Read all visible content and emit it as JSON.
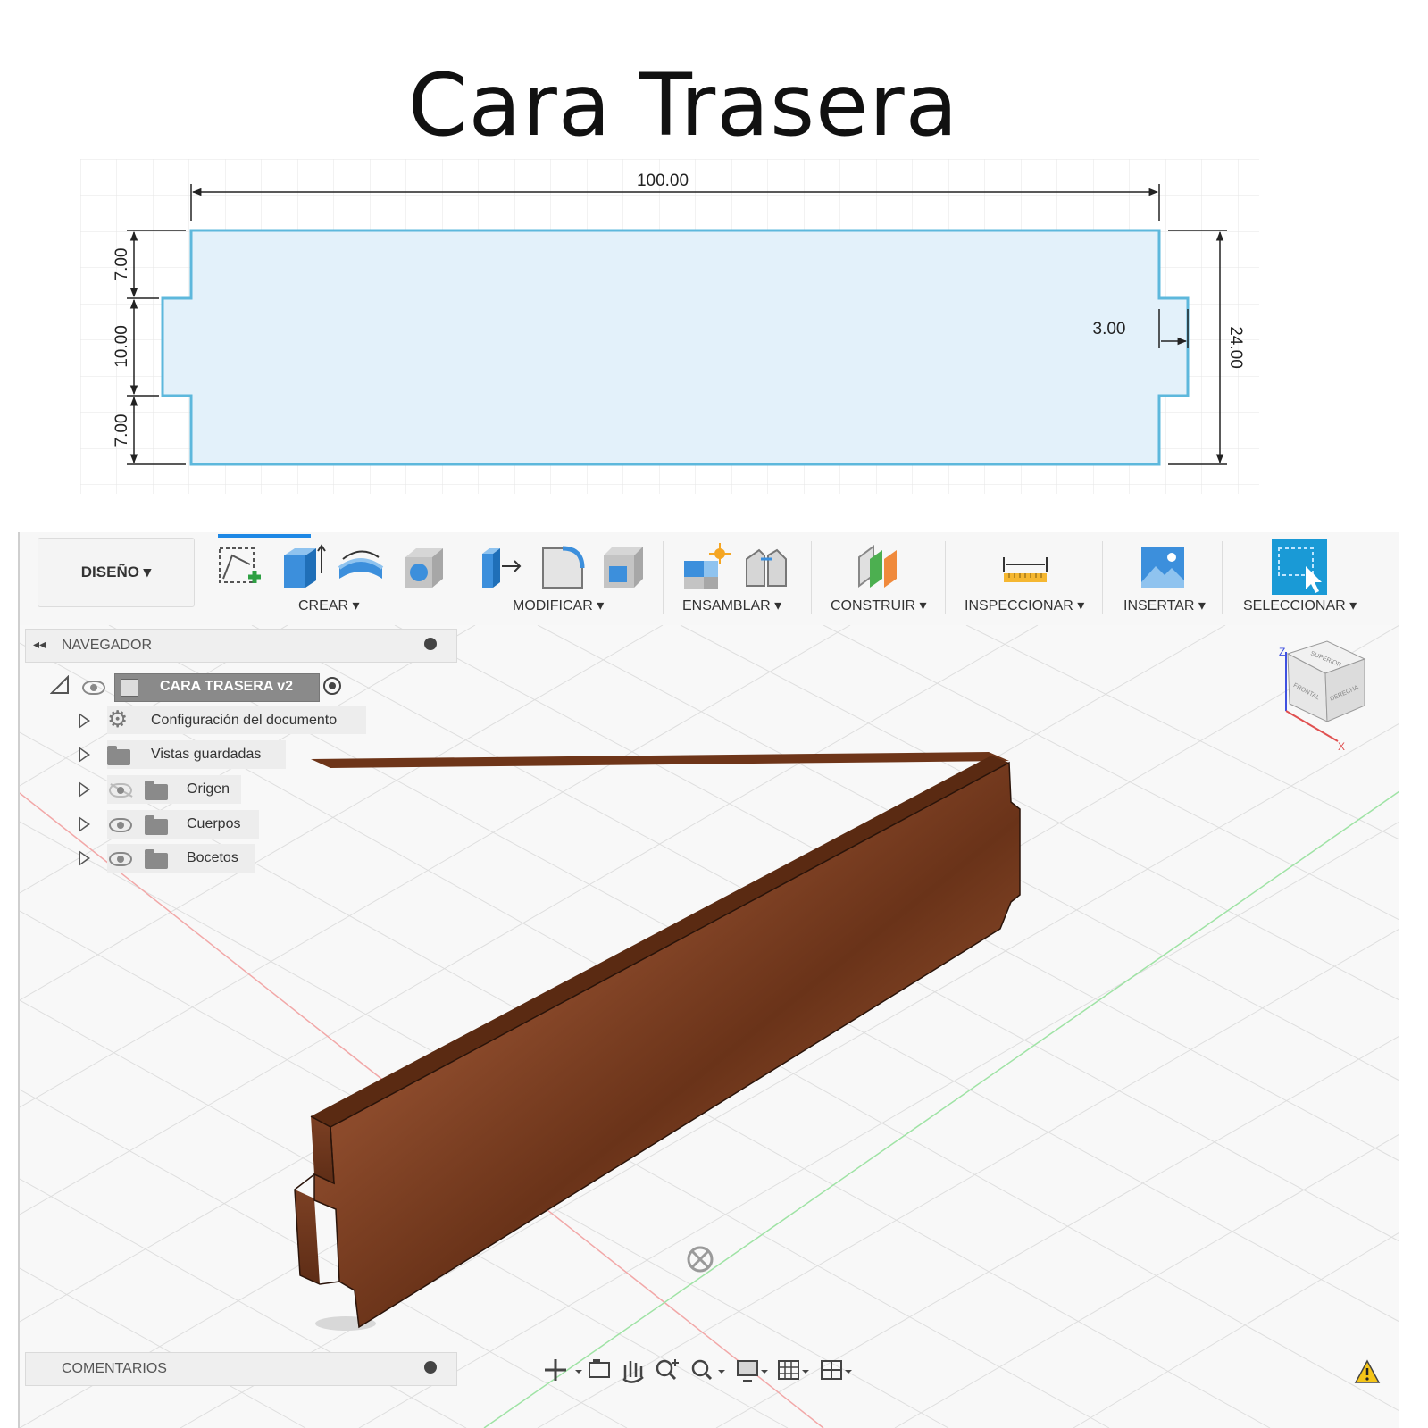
{
  "title": "Cara Trasera",
  "sketch": {
    "dimensions": {
      "width": "100.00",
      "left_top": "7.00",
      "left_middle": "10.00",
      "left_bottom": "7.00",
      "tab": "3.00",
      "height": "24.00"
    },
    "colors": {
      "fill": "#e3f1fa",
      "outline": "#5db8dc",
      "dimension": "#222222"
    }
  },
  "toolbar": {
    "design_label": "DISEÑO ▾",
    "groups": [
      {
        "label": "CREAR ▾",
        "icons": [
          "new-sketch-icon",
          "extrude-icon",
          "revolve-icon",
          "hole-icon"
        ]
      },
      {
        "label": "MODIFICAR ▾",
        "icons": [
          "press-pull-icon",
          "fillet-icon",
          "shell-icon"
        ]
      },
      {
        "label": "ENSAMBLAR ▾",
        "icons": [
          "new-component-icon",
          "joint-icon"
        ]
      },
      {
        "label": "CONSTRUIR ▾",
        "icons": [
          "offset-plane-icon"
        ]
      },
      {
        "label": "INSPECCIONAR ▾",
        "icons": [
          "measure-icon"
        ]
      },
      {
        "label": "INSERTAR ▾",
        "icons": [
          "insert-image-icon"
        ]
      },
      {
        "label": "SELECCIONAR ▾",
        "icons": [
          "select-icon"
        ]
      }
    ]
  },
  "navigator": {
    "header": "NAVEGADOR",
    "root": "CARA TRASERA v2",
    "items": [
      {
        "label": "Configuración del documento",
        "icon": "gear-icon"
      },
      {
        "label": "Vistas guardadas",
        "icon": "folder-icon"
      },
      {
        "label": "Origen",
        "icon": "folder-icon",
        "visibility": "hidden"
      },
      {
        "label": "Cuerpos",
        "icon": "folder-icon",
        "visibility": "visible"
      },
      {
        "label": "Bocetos",
        "icon": "folder-icon",
        "visibility": "visible"
      }
    ]
  },
  "viewcube": {
    "axis_z": "Z",
    "axis_x": "X",
    "face_top": "SUPERIOR",
    "face_front": "FRONTAL",
    "face_right": "DERECHA"
  },
  "comments": {
    "label": "COMENTARIOS"
  },
  "body_color": "#8b4a2b"
}
